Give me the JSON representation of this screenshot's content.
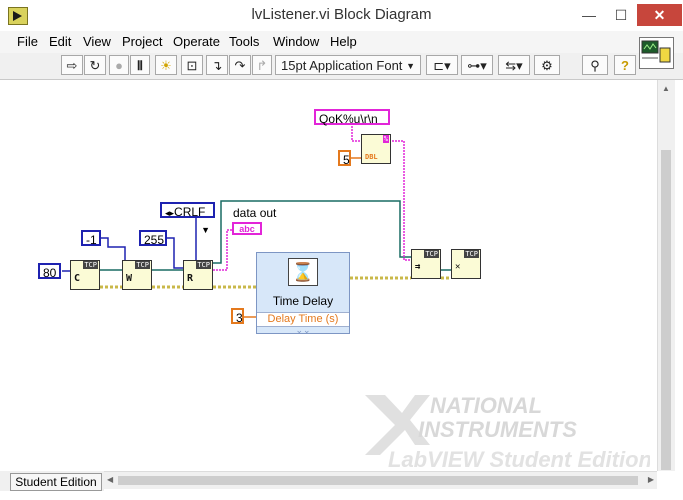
{
  "window": {
    "title": "lvListener.vi Block Diagram",
    "minimize_glyph": "—",
    "maximize_glyph": "☐",
    "close_glyph": "✕"
  },
  "menu": [
    "File",
    "Edit",
    "View",
    "Project",
    "Operate",
    "Tools",
    "Window",
    "Help"
  ],
  "toolbar": {
    "font_select": "15pt Application Font",
    "icons": [
      "run-arrow-icon",
      "run-continuous-icon",
      "abort-icon",
      "pause-icon",
      "highlight-execution-icon",
      "retain-wire-values-icon",
      "step-into-icon",
      "step-over-icon",
      "step-out-icon",
      "align-icon",
      "distribute-icon",
      "resize-icon",
      "reorder-icon",
      "cleanup-icon",
      "search-icon",
      "help-icon"
    ]
  },
  "diagram": {
    "constants": {
      "port": "80",
      "timeout": "-1",
      "bytes": "255",
      "crlf": "CRLF",
      "format": "QoK%u\\r\\n",
      "five": "5",
      "delay": "3"
    },
    "indicator_label": "data out",
    "indicator_text": "abc",
    "node_tags": {
      "tcp": "TCP",
      "fmt": "%",
      "dbl": "DBL"
    },
    "node_glyphs": {
      "listen": "C",
      "write": "W",
      "read": "R"
    },
    "time_delay": {
      "title": "Time Delay",
      "param": "Delay Time (s)",
      "expand_glyph": "⌄⌄",
      "icon_glyph": "⌛"
    }
  },
  "status": {
    "edition": "Student Edition"
  },
  "watermark": {
    "line1": "NATIONAL",
    "line2": "INSTRUMENTS",
    "line3": "LabVIEW Student Edition"
  },
  "colors": {
    "blue_wire": "#1e22b0",
    "orange_const": "#e4791d",
    "pink_string": "#e225d8",
    "tcp_wire": "#196b63",
    "error_wire": "#c9b84a"
  }
}
